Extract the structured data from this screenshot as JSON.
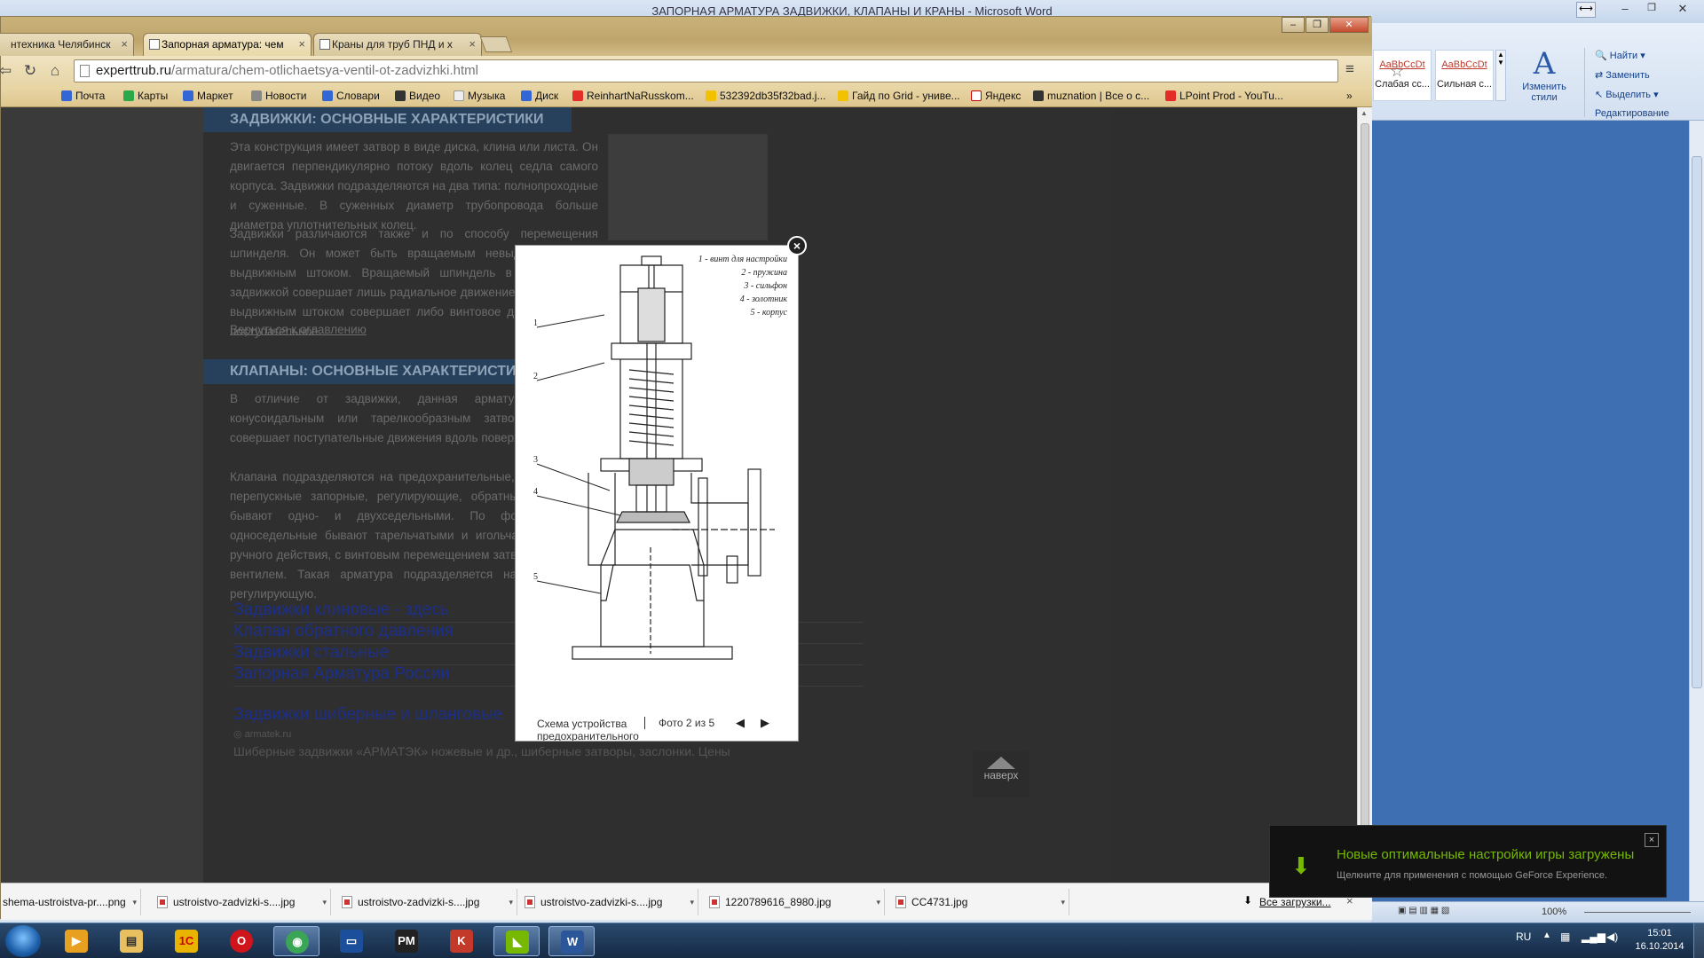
{
  "word": {
    "title": "ЗАПОРНАЯ АРМАТУРА ЗАДВИЖКИ, КЛАПАНЫ И КРАНЫ - Microsoft Word",
    "styles": [
      {
        "sample": "AaBbCcDt",
        "name": "Слабая сс..."
      },
      {
        "sample": "AaBbCcDt",
        "name": "Сильная с..."
      }
    ],
    "change_styles": "Изменить стили",
    "find": "Найти",
    "replace": "Заменить",
    "select": "Выделить",
    "group_label": "Редактирование",
    "zoom": "100%"
  },
  "browser": {
    "tabs": [
      {
        "label": "нтехника Челябинск"
      },
      {
        "label": "Запорная арматура: чем"
      },
      {
        "label": "Краны для труб ПНД и х"
      }
    ],
    "url_domain": "experttrub.ru",
    "url_path": "/armatura/chem-otlichaetsya-ventil-ot-zadvizhki.html",
    "bookmarks": [
      {
        "label": "Почта",
        "color": "#3367d6"
      },
      {
        "label": "Карты",
        "color": "#2aa84a"
      },
      {
        "label": "Маркет",
        "color": "#3367d6"
      },
      {
        "label": "Новости",
        "color": "#888888"
      },
      {
        "label": "Словари",
        "color": "#3367d6"
      },
      {
        "label": "Видео",
        "color": "#333333"
      },
      {
        "label": "Музыка",
        "color": "#eeeeee"
      },
      {
        "label": "Диск",
        "color": "#3367d6"
      },
      {
        "label": "ReinhartNaRusskom...",
        "color": "#e52d27"
      },
      {
        "label": "532392db35f32bad.j...",
        "color": "#f2c200"
      },
      {
        "label": "Гайд по Grid - униве...",
        "color": "#f2c200"
      },
      {
        "label": "Яндекс",
        "color": "#ffffff"
      },
      {
        "label": "muznation | Все о с...",
        "color": "#333333"
      },
      {
        "label": "LPoint Prod - YouTu...",
        "color": "#e52d27"
      }
    ]
  },
  "page": {
    "section1_title": "ЗАДВИЖКИ: ОСНОВНЫЕ ХАРАКТЕРИСТИКИ",
    "section1_p1": "Эта конструкция имеет затвор в виде диска, клина или листа. Он двигается перпендикулярно потоку вдоль колец седла самого корпуса. Задвижки подразделяются на два типа: полнопроходные и суженные. В суженных диаметр трубопровода больше диаметра уплотнительных колец.",
    "section1_p2": "Задвижки различаются также и по способу перемещения шпинделя. Он может быть вращаемым невыдвижным и с выдвижным штоком. Вращаемый шпиндель в невыдвижной задвижкой совершает лишь радиальное движение, а шпиндель с выдвижным штоком совершает либо винтовое движение, либо поступательное.",
    "back_link": "Вернуться к оглавлению",
    "section2_title": "КЛАПАНЫ: ОСНОВНЫЕ ХАРАКТЕРИСТИКИ",
    "section2_p1": "В отличие от задвижки, данная арматура снабжена конусоидальным или тарелкообразным затвором, который совершает поступательные движения вдоль поверхности седла.",
    "section2_p2": "Клапана подразделяются на предохранительные, дыхательные, перепускные запорные, регулирующие, обратные и др. Они бывают одно- и двухседельными. По форме затвора односедельные бывают тарельчатыми и игольчатыми. Клапан ручного действия, с винтовым перемещением затвора, называют вентилем. Такая арматура подразделяется на запорную и регулирующую.",
    "ads": [
      "Задвижки клиновые - здесь",
      "Клапан обратного давления",
      "Задвижки стальные",
      "Запорная Арматура России"
    ],
    "ad_title": "Задвижки шиберные и шланговые",
    "ad_domain": "armatek.ru",
    "ad_desc": "Шиберные задвижки «АРМАТЭК» ножевые и др., шиберные затворы, заслонки. Цены",
    "up_label": "наверх"
  },
  "lightbox": {
    "legend": [
      "1 - винт для настройки",
      "2 - пружина",
      "3 - сильфон",
      "4 - золотник",
      "5 - корпус"
    ],
    "callouts": [
      "1",
      "2",
      "3",
      "4",
      "5"
    ],
    "caption": "Схема устройства предохранительного",
    "counter": "Фото 2 из 5"
  },
  "downloads": {
    "items": [
      "shema-ustroistva-pr....png",
      "ustroistvo-zadvizki-s....jpg",
      "ustroistvo-zadvizki-s....jpg",
      "ustroistvo-zadvizki-s....jpg",
      "1220789616_8980.jpg",
      "CC4731.jpg"
    ],
    "all_label": "Все загрузки..."
  },
  "toast": {
    "title": "Новые оптимальные настройки игры загружены",
    "subtitle": "Щелкните для применения с помощью GeForce Experience."
  },
  "taskbar": {
    "lang": "RU",
    "time": "15:01",
    "date": "16.10.2014",
    "apps": [
      {
        "name": "media-player-icon",
        "glyph": "▶",
        "color": "#e8a020"
      },
      {
        "name": "explorer-icon",
        "glyph": "▤",
        "color": "#e8c060"
      },
      {
        "name": "1c-icon",
        "glyph": "1С",
        "color": "#e8b400"
      },
      {
        "name": "opera-icon",
        "glyph": "O",
        "color": "#d0141b"
      },
      {
        "name": "chrome-icon",
        "glyph": "◉",
        "color": "#3aa655"
      },
      {
        "name": "samsung-icon",
        "glyph": "▭",
        "color": "#1b4f9c"
      },
      {
        "name": "pm-icon",
        "glyph": "PM",
        "color": "#222222"
      },
      {
        "name": "app-red-icon",
        "glyph": "K",
        "color": "#c43a2a"
      },
      {
        "name": "nvidia-icon",
        "glyph": "◣",
        "color": "#76b900"
      },
      {
        "name": "word-icon",
        "glyph": "W",
        "color": "#2b579a"
      }
    ]
  }
}
